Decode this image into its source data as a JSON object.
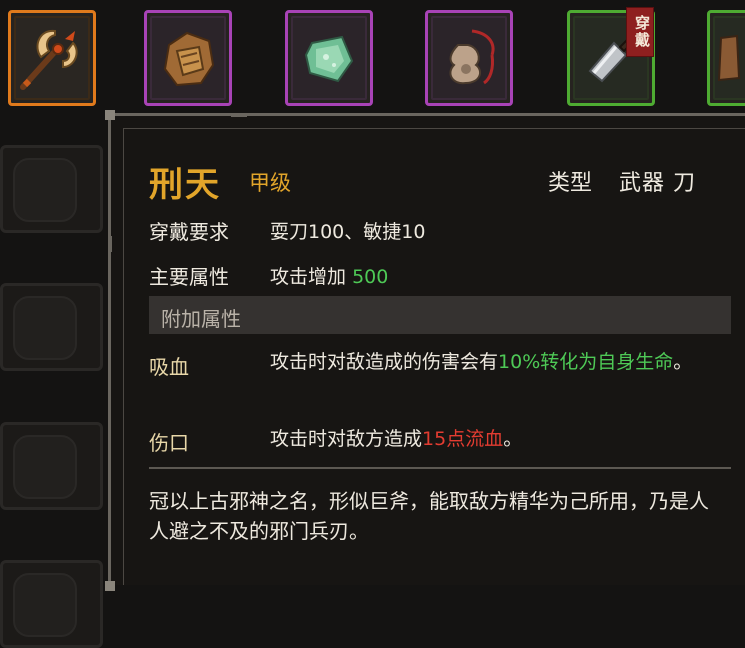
{
  "inventory": {
    "top_slots": [
      {
        "name": "axe",
        "rarity": "orange",
        "color": "#e07a1c"
      },
      {
        "name": "armor",
        "rarity": "purple",
        "color": "#a843b6"
      },
      {
        "name": "jade",
        "rarity": "purple",
        "color": "#a843b6"
      },
      {
        "name": "gourd",
        "rarity": "purple",
        "color": "#a843b6"
      },
      {
        "name": "cleaver",
        "rarity": "green",
        "color": "#4eab32",
        "tag": "穿戴"
      },
      {
        "name": "partial-item",
        "rarity": "green",
        "color": "#4eab32"
      }
    ]
  },
  "tooltip": {
    "title": "刑天",
    "grade": "甲级",
    "type_label": "类型",
    "type_value": "武器 刀",
    "requirement_label": "穿戴要求",
    "requirement_value": "耍刀100、敏捷10",
    "main_attr_label": "主要属性",
    "main_attr_text": "攻击增加",
    "main_attr_value": "500",
    "extra_section": "附加属性",
    "bonuses": [
      {
        "label": "吸血",
        "text_before": "攻击时对敌造成的伤害会有",
        "highlight": "10%转化为自身生命",
        "text_after": "。",
        "highlight_color": "#4ec956"
      },
      {
        "label": "伤口",
        "text_before": "攻击时对敌方造成",
        "highlight": "15点流血",
        "text_after": "。",
        "highlight_color": "#e33c31"
      }
    ],
    "flavor": "冠以上古邪神之名，形似巨斧，能取敌方精华为己所用，乃是人人避之不及的邪门兵刃。"
  },
  "colors": {
    "gold": "#e2a52a",
    "green": "#4ec956",
    "red": "#e33c31",
    "panel_bg": "#171513"
  }
}
